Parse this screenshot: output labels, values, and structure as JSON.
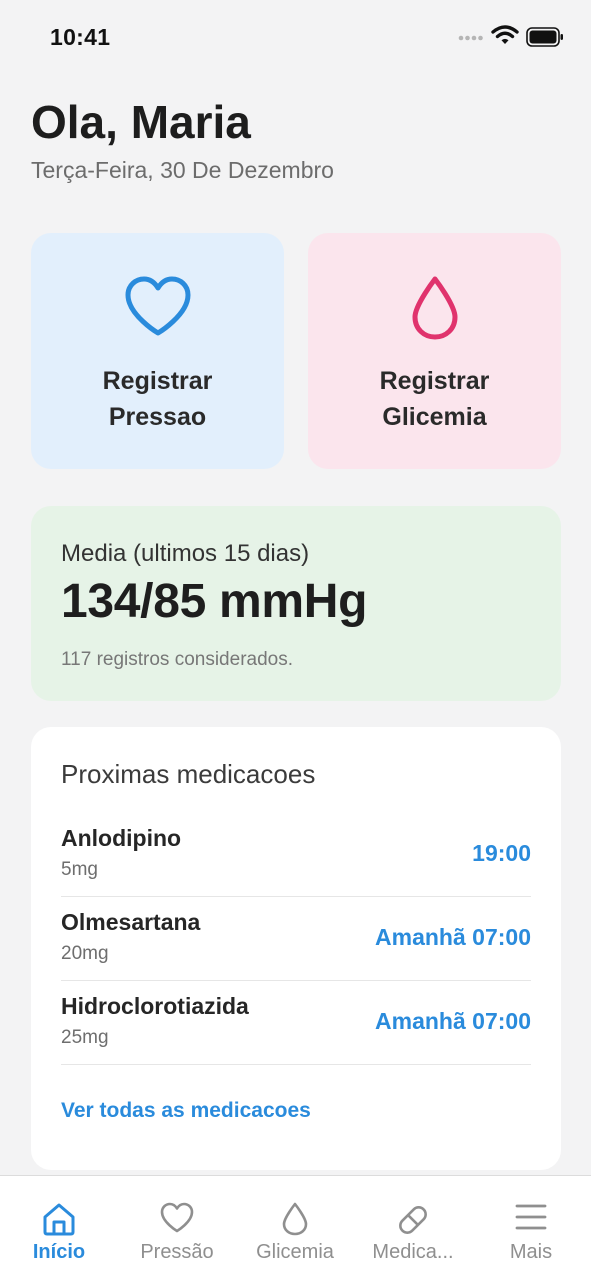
{
  "status_bar": {
    "time": "10:41"
  },
  "header": {
    "greeting": "Ola, Maria",
    "date": "Terça-Feira, 30 De Dezembro"
  },
  "actions": [
    {
      "label": "Registrar Pressao",
      "icon": "heart-icon",
      "color": "#2a8bdc",
      "background": "#e2effc"
    },
    {
      "label": "Registrar Glicemia",
      "icon": "drop-icon",
      "color": "#e0336d",
      "background": "#fbe5ed"
    }
  ],
  "average": {
    "title": "Media (ultimos 15 dias)",
    "value": "134/85 mmHg",
    "subtitle": "117 registros considerados.",
    "background": "#e6f3e7"
  },
  "medications": {
    "title": "Proximas medicacoes",
    "items": [
      {
        "name": "Anlodipino",
        "dose": "5mg",
        "time": "19:00"
      },
      {
        "name": "Olmesartana",
        "dose": "20mg",
        "time": "Amanhã 07:00"
      },
      {
        "name": "Hidroclorotiazida",
        "dose": "25mg",
        "time": "Amanhã 07:00"
      }
    ],
    "see_all": "Ver todas as medicacoes"
  },
  "tab_bar": {
    "active_color": "#2a8bdc",
    "inactive_color": "#8f8f8f",
    "tabs": [
      {
        "label": "Início",
        "icon": "home-icon",
        "active": true
      },
      {
        "label": "Pressão",
        "icon": "heart-icon",
        "active": false
      },
      {
        "label": "Glicemia",
        "icon": "drop-icon",
        "active": false
      },
      {
        "label": "Medica...",
        "icon": "pill-icon",
        "active": false
      },
      {
        "label": "Mais",
        "icon": "menu-icon",
        "active": false
      }
    ]
  }
}
